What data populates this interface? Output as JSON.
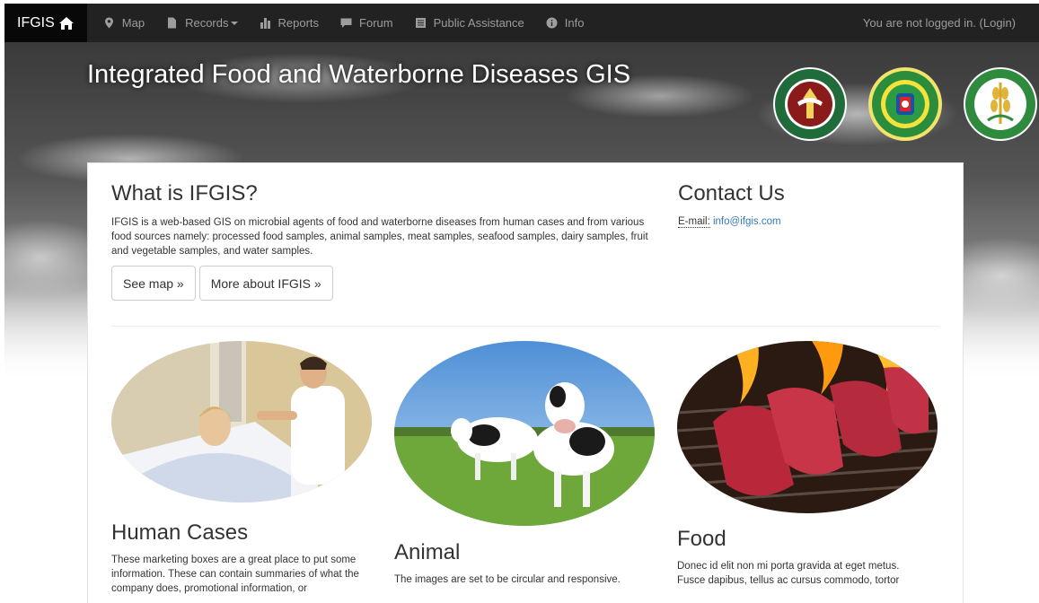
{
  "nav": {
    "brand": "IFGIS",
    "items": [
      {
        "label": "Map",
        "icon": "map-marker-icon"
      },
      {
        "label": "Records",
        "icon": "file-icon",
        "has_dropdown": true
      },
      {
        "label": "Reports",
        "icon": "bar-chart-icon"
      },
      {
        "label": "Forum",
        "icon": "comment-icon"
      },
      {
        "label": "Public Assistance",
        "icon": "list-alt-icon"
      },
      {
        "label": "Info",
        "icon": "info-circle-icon"
      }
    ],
    "login_text": "You are not logged in. (Login)"
  },
  "hero": {
    "title": "Integrated Food and Waterborne Diseases GIS"
  },
  "about": {
    "heading": "What is IFGIS?",
    "text": "IFGIS is a web-based GIS on microbial agents of food and waterborne diseases from human cases and from various food sources namely: processed food samples, animal samples, meat samples, seafood samples, dairy samples, fruit and vegetable samples, and water samples.",
    "see_map": "See map »",
    "more": "More about IFGIS »"
  },
  "contact": {
    "heading": "Contact Us",
    "email_label": "E-mail:",
    "email": "info@ifgis.com"
  },
  "features": [
    {
      "title": "Human Cases",
      "text": "These marketing boxes are a great place to put some information. These can contain summaries of what the company does, promotional information, or"
    },
    {
      "title": "Animal",
      "text": "The images are set to be circular and responsive."
    },
    {
      "title": "Food",
      "text": "Donec id elit non mi porta gravida at eget metus. Fusce dapibus, tellus ac cursus commodo, tortor"
    }
  ],
  "colors": {
    "navbar": "#222222",
    "brand_bg": "#080808",
    "nav_text": "#9d9d9d",
    "link": "#337ab7"
  }
}
